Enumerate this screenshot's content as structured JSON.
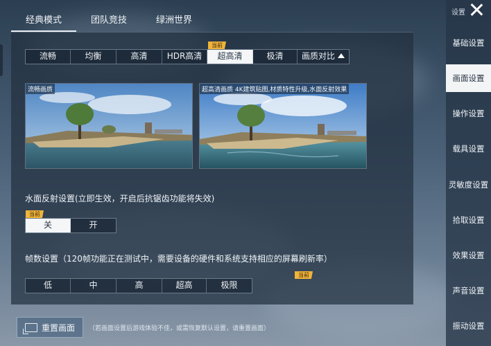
{
  "top_tabs": [
    {
      "label": "经典模式",
      "active": true
    },
    {
      "label": "团队竞技",
      "active": false
    },
    {
      "label": "绿洲世界",
      "active": false
    }
  ],
  "quality": {
    "badge": "当前",
    "options": [
      "流畅",
      "均衡",
      "高清",
      "HDR高清",
      "超高清",
      "极清"
    ],
    "selected": "超高清",
    "compare_label": "画质对比"
  },
  "previews": {
    "left_caption": "流畅画质",
    "right_caption": "超高清画质 4K建筑贴图,材质特性升级,水面反射效果"
  },
  "water": {
    "title": "水面反射设置(立即生效，开启后抗锯齿功能将失效)",
    "badge": "当前",
    "options": [
      "关",
      "开"
    ],
    "selected": "关"
  },
  "fps": {
    "title": "帧数设置（120帧功能正在测试中，需要设备的硬件和系统支持相应的屏幕刷新率）",
    "badge": "当前",
    "options": [
      "低",
      "中",
      "高",
      "超高",
      "极限"
    ],
    "selected": "极限"
  },
  "reset": {
    "label": "重置画面",
    "note": "（若画面设置后游戏体验不佳，或需恢复默认设置，请重置画面）"
  },
  "sidebar": {
    "title": "设置",
    "items": [
      {
        "label": "基础设置",
        "active": false
      },
      {
        "label": "画面设置",
        "active": true
      },
      {
        "label": "操作设置",
        "active": false
      },
      {
        "label": "载具设置",
        "active": false
      },
      {
        "label": "灵敏度设置",
        "active": false
      },
      {
        "label": "拾取设置",
        "active": false
      },
      {
        "label": "效果设置",
        "active": false
      },
      {
        "label": "声音设置",
        "active": false
      },
      {
        "label": "振动设置",
        "active": false
      }
    ]
  },
  "icons": {
    "close": "close-icon",
    "compare": "triangle-up-icon",
    "reset": "screen-reset-icon"
  }
}
